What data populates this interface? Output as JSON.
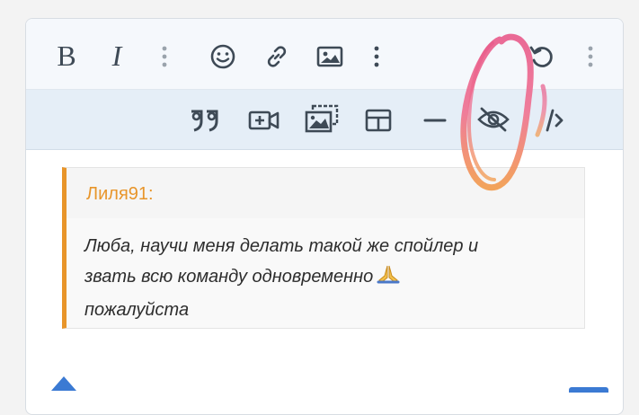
{
  "toolbar": {
    "bold_label": "B",
    "italic_label": "I",
    "icons": {
      "more": "more-vertical-icon",
      "emoji": "smiley-icon",
      "link": "link-icon",
      "image": "image-icon",
      "undo": "undo-icon",
      "quote": "quote-icon",
      "media": "video-add-icon",
      "gallery": "gallery-icon",
      "table": "table-icon",
      "hr": "horizontal-rule-icon",
      "spoiler": "eye-off-icon",
      "code": "code-icon"
    }
  },
  "quote": {
    "author": "Лиля91:",
    "line1": "Люба, научи меня делать такой же спойлер и",
    "line2": "звать всю команду одновременно",
    "line3": "пожалуйста",
    "emoji": "praying-hands-icon"
  },
  "colors": {
    "accent_orange": "#e8952a",
    "toolbar_bg": "#f5f8fc",
    "toolbar2_bg": "#e5eef7",
    "icon": "#3e4a56",
    "scribble_pink": "#e85a8a",
    "scribble_orange": "#f29a4a",
    "blue": "#3b7ad3"
  }
}
